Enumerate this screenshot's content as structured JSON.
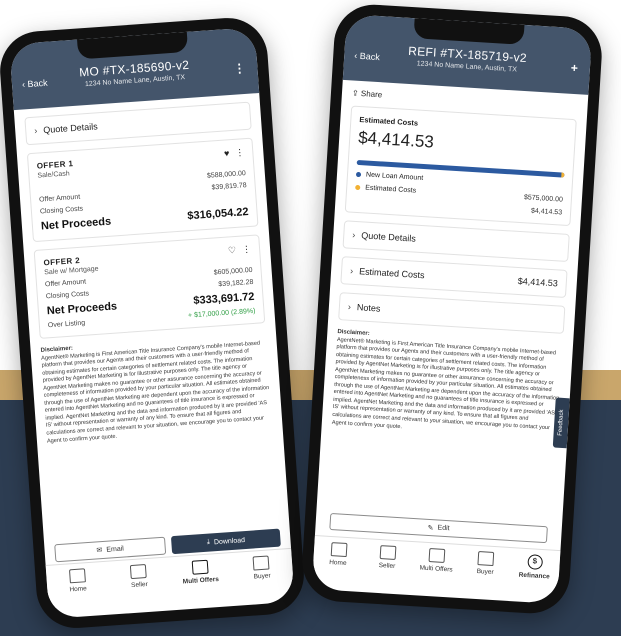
{
  "left": {
    "appbar": {
      "back_label": "Back",
      "title": "MO #TX-185690-v2",
      "subtitle": "1234 No Name Lane, Austin, TX"
    },
    "quote_details_label": "Quote Details",
    "offers": [
      {
        "title": "OFFER 1",
        "subtitle": "Sale/Cash",
        "top_value": "$588,000.00",
        "offer_amount_label": "Offer Amount",
        "offer_amount": "$39,819.78",
        "closing_costs_label": "Closing Costs",
        "net_label": "Net Proceeds",
        "net_value": "$316,054.22"
      },
      {
        "title": "OFFER 2",
        "subtitle": "Sale w/ Mortgage",
        "offer_amount_label": "Offer Amount",
        "offer_amount": "$605,000.00",
        "closing_costs_label": "Closing Costs",
        "closing_costs": "$39,182.28",
        "net_label": "Net Proceeds",
        "net_value": "$333,691.72",
        "extra_label": "Over Listing",
        "extra_value": "+ $17,000.00 (2.89%)"
      }
    ],
    "disclaimer_title": "Disclaimer:",
    "disclaimer_text": "AgentNet® Marketing is First American Title Insurance Company's mobile Internet-based platform that provides our Agents and their customers with a user-friendly method of obtaining estimates for certain categories of settlement related costs. The information provided by AgentNet Marketing is for illustrative purposes only. The title agency or AgentNet Marketing makes no guarantee or other assurance concerning the accuracy or completeness of information provided by your particular situation. All estimates obtained through the use of AgentNet Marketing are dependent upon the accuracy of the information entered into AgentNet Marketing and no guarantees of title insurance is expressed or implied. AgentNet Marketing and the data and information produced by it are provided 'AS IS' without representation or warranty of any kind. To ensure that all figures and calculations are correct and relevant to your situation, we encourage you to contact your Agent to confirm your quote.",
    "email_label": "Email",
    "download_label": "Download",
    "tabs": [
      "Home",
      "Seller",
      "Multi Offers",
      "Buyer"
    ]
  },
  "right": {
    "appbar": {
      "back_label": "Back",
      "title": "REFI #TX-185719-v2",
      "subtitle": "1234 No Name Lane, Austin, TX",
      "plus": "+"
    },
    "share_label": "Share",
    "estimated_costs_title": "Estimated Costs",
    "estimated_costs_amount": "$4,414.53",
    "estimated_share_fraction": 0.008,
    "legend": [
      {
        "label": "New Loan Amount",
        "color": "#2c5aa0",
        "value": "$575,000.00"
      },
      {
        "label": "Estimated Costs",
        "color": "#f2b134",
        "value": "$4,414.53"
      }
    ],
    "quote_details_label": "Quote Details",
    "estimated_costs_row_label": "Estimated Costs",
    "estimated_costs_row_value": "$4,414.53",
    "notes_label": "Notes",
    "disclaimer_title": "Disclaimer:",
    "disclaimer_text": "AgentNet® Marketing is First American Title Insurance Company's mobile Internet-based platform that provides our Agents and their customers with a user-friendly method of obtaining estimates for certain categories of settlement related costs. The information provided by AgentNet Marketing is for illustrative purposes only. The title agency or AgentNet Marketing makes no guarantee or other assurance concerning the accuracy or completeness of information provided by your particular situation. All estimates obtained through the use of AgentNet Marketing are dependent upon the accuracy of the information entered into AgentNet Marketing and no guarantees of title insurance is expressed or implied. AgentNet Marketing and the data and information produced by it are provided 'AS IS' without representation or warranty of any kind. To ensure that all figures and calculations are correct and relevant to your situation, we encourage you to contact your Agent to confirm your quote.",
    "feedback_label": "Feedback",
    "edit_label": "Edit",
    "tabs": [
      "Home",
      "Seller",
      "Multi Offers",
      "Buyer",
      "Refinance"
    ]
  }
}
